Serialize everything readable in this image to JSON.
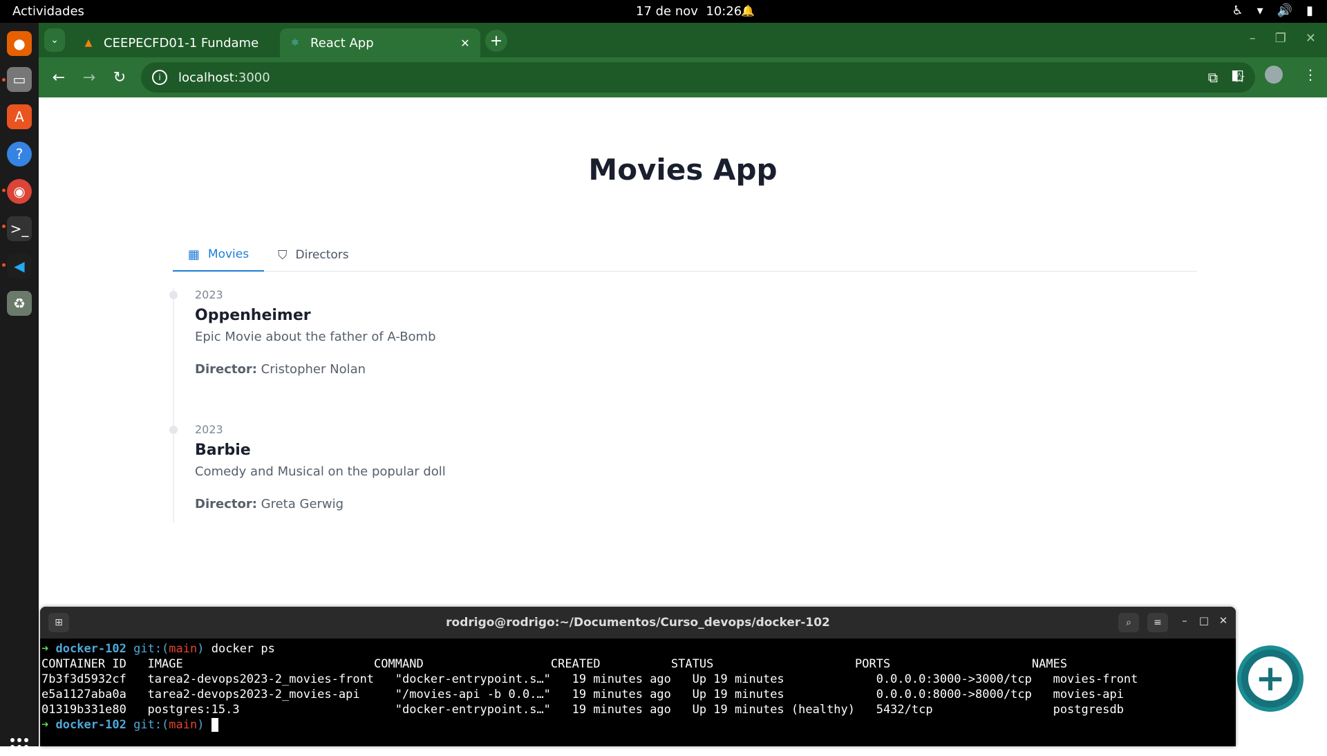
{
  "topbar": {
    "activities": "Actividades",
    "date": "17 de nov",
    "time": "10:26"
  },
  "browser": {
    "tabs": [
      {
        "title": "CEEPECFD01-1 Fundame",
        "icon": "moodle-icon",
        "active": false
      },
      {
        "title": "React App",
        "icon": "react-icon",
        "active": true
      }
    ],
    "url_host": "localhost",
    "url_port": ":3000"
  },
  "page": {
    "title": "Movies App",
    "tabs": [
      {
        "label": "Movies",
        "active": true
      },
      {
        "label": "Directors",
        "active": false
      }
    ],
    "movies": [
      {
        "year": "2023",
        "title": "Oppenheimer",
        "description": "Epic Movie about the father of A-Bomb",
        "director_label": "Director:",
        "director": "Cristopher Nolan"
      },
      {
        "year": "2023",
        "title": "Barbie",
        "description": "Comedy and Musical on the popular doll",
        "director_label": "Director:",
        "director": "Greta Gerwig"
      }
    ]
  },
  "terminal": {
    "title": "rodrigo@rodrigo:~/Documentos/Curso_devops/docker-102",
    "prompt_arrow": "➜",
    "cwd": "docker-102",
    "git_prefix": "git:(",
    "branch": "main",
    "git_suffix": ")",
    "command": "docker ps",
    "header": "CONTAINER ID   IMAGE                           COMMAND                  CREATED          STATUS                    PORTS                    NAMES",
    "rows": [
      "7b3f3d5932cf   tarea2-devops2023-2_movies-front   \"docker-entrypoint.s…\"   19 minutes ago   Up 19 minutes             0.0.0.0:3000->3000/tcp   movies-front",
      "e5a1127aba0a   tarea2-devops2023-2_movies-api     \"/movies-api -b 0.0.…\"   19 minutes ago   Up 19 minutes             0.0.0.0:8000->8000/tcp   movies-api",
      "01319b331e80   postgres:15.3                      \"docker-entrypoint.s…\"   19 minutes ago   Up 19 minutes (healthy)   5432/tcp                 postgresdb"
    ]
  }
}
